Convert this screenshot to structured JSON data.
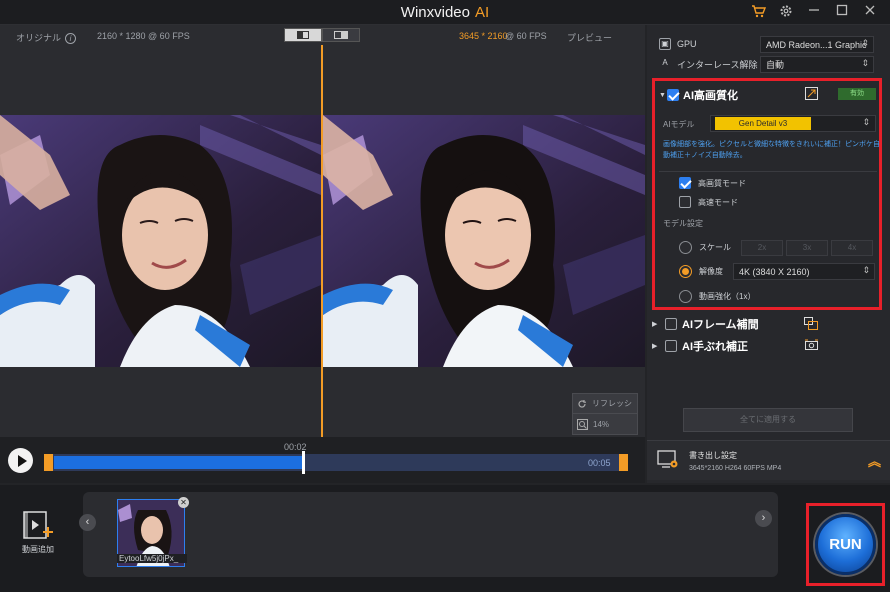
{
  "app": {
    "title": "Winxvideo",
    "title_ai": "AI"
  },
  "preview": {
    "original_label": "オリジナル",
    "original_res": "2160 * 1280 @ 60 FPS",
    "output_res": "3645 * 2160",
    "output_fps": " @ 60 FPS",
    "preview_label": "プレビュー",
    "refresh_label": "リフレッシ",
    "zoom_label": "14%"
  },
  "timeline": {
    "current_time": "00:02",
    "end_time": "00:05",
    "progress": 0.44
  },
  "settings": {
    "gpu_label": "GPU",
    "gpu_value": "AMD Radeon...1 Graphic",
    "deinterlace_label": "インターレース解除",
    "deinterlace_value": "自動"
  },
  "enhance": {
    "title": "AI高画質化",
    "badge": "有効",
    "model_label": "AIモデル",
    "model_value": "Gen Detail v3",
    "description": "画像細部を強化。ピクセルと微細な特徴をきれいに補正！ピンボケ自動補正＋ノイズ自動除去。",
    "hq_mode": "高画質モード",
    "fast_mode": "高速モード",
    "model_settings": "モデル設定",
    "scale_label": "スケール",
    "scale_options": [
      "2x",
      "3x",
      "4x"
    ],
    "resolution_label": "解像度",
    "resolution_value": "4K (3840 X 2160)",
    "video_enhance": "動画強化（1x）"
  },
  "features": {
    "frame_interp": "AIフレーム補間",
    "stabilize": "AI手ぶれ補正"
  },
  "apply_all": "全てに適用する",
  "export": {
    "title": "書き出し設定",
    "details": "3645*2160  H264  60FPS  MP4"
  },
  "tray": {
    "add_video": "動画追加",
    "file_name": "EytooLfw5j0jPx_"
  },
  "run_label": "RUN",
  "colors": {
    "accent": "#f39c26",
    "highlight": "#e8202a",
    "blue": "#2d7ff0"
  }
}
